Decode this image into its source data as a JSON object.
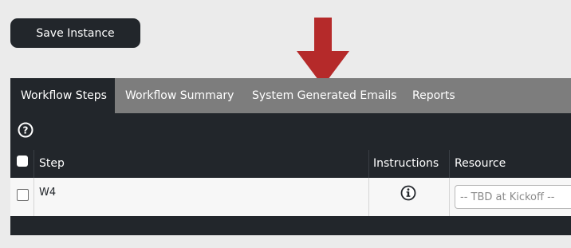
{
  "toolbar": {
    "save_label": "Save Instance"
  },
  "tabs": [
    {
      "label": "Workflow Steps",
      "active": true
    },
    {
      "label": "Workflow Summary",
      "active": false
    },
    {
      "label": "System Generated Emails",
      "active": false
    },
    {
      "label": "Reports",
      "active": false
    }
  ],
  "table": {
    "headers": {
      "step": "Step",
      "instructions": "Instructions",
      "resource": "Resource"
    },
    "rows": [
      {
        "step": "W4",
        "resource_placeholder": "-- TBD at Kickoff --"
      }
    ]
  },
  "colors": {
    "annotation_arrow": "#b52a2a",
    "dark": "#22262b",
    "tab_bar": "#7d7d7d"
  }
}
